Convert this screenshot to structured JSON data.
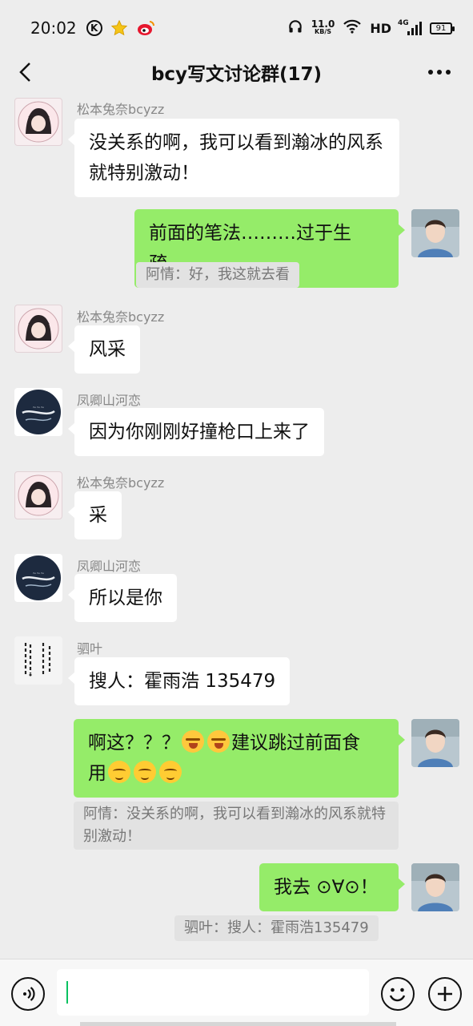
{
  "status_bar": {
    "time": "20:02",
    "speed_value": "11.0",
    "speed_unit": "KB/S",
    "hd": "HD",
    "network": "4G",
    "battery": "91",
    "icons": [
      "k-icon",
      "star-icon",
      "weibo-icon",
      "headphones-icon",
      "wifi-icon",
      "signal-icon",
      "battery-icon"
    ]
  },
  "header": {
    "title": "bcy写文讨论群(17)",
    "back_icon": "chevron-left-icon",
    "more_icon": "more-dots-icon"
  },
  "messages": [
    {
      "side": "in",
      "sender": "松本兔奈bcyzz",
      "text": "没关系的啊，我可以看到瀚冰的风系就特别激动！"
    },
    {
      "side": "out",
      "text": "前面的笔法………过于生疏…",
      "quote": "阿情：好，我这就去看"
    },
    {
      "side": "in",
      "sender": "松本兔奈bcyzz",
      "text": "风采"
    },
    {
      "side": "in",
      "sender": "凤卿山河恋",
      "text": "因为你刚刚好撞枪口上来了"
    },
    {
      "side": "in",
      "sender": "松本兔奈bcyzz",
      "text": "采"
    },
    {
      "side": "in",
      "sender": "凤卿山河恋",
      "text": "所以是你"
    },
    {
      "side": "in",
      "sender": "驷叶",
      "text": "搜人：霍雨浩 135479"
    },
    {
      "side": "out",
      "text_parts": [
        "啊这？？？",
        "建议跳过前面食",
        "用"
      ],
      "quote": "阿情：没关系的啊，我可以看到瀚冰的风系就特别激动！"
    },
    {
      "side": "out",
      "text": "我去 ⊙∀⊙！",
      "quote": "驷叶：搜人：霍雨浩135479"
    }
  ],
  "input_bar": {
    "value": "",
    "icons": [
      "voice-icon",
      "emoji-face-icon",
      "plus-icon"
    ]
  },
  "colors": {
    "background": "#ededed",
    "bubble_in": "#ffffff",
    "bubble_out": "#95ec69",
    "quote_bg": "#e2e2e2",
    "caret": "#07c160"
  }
}
